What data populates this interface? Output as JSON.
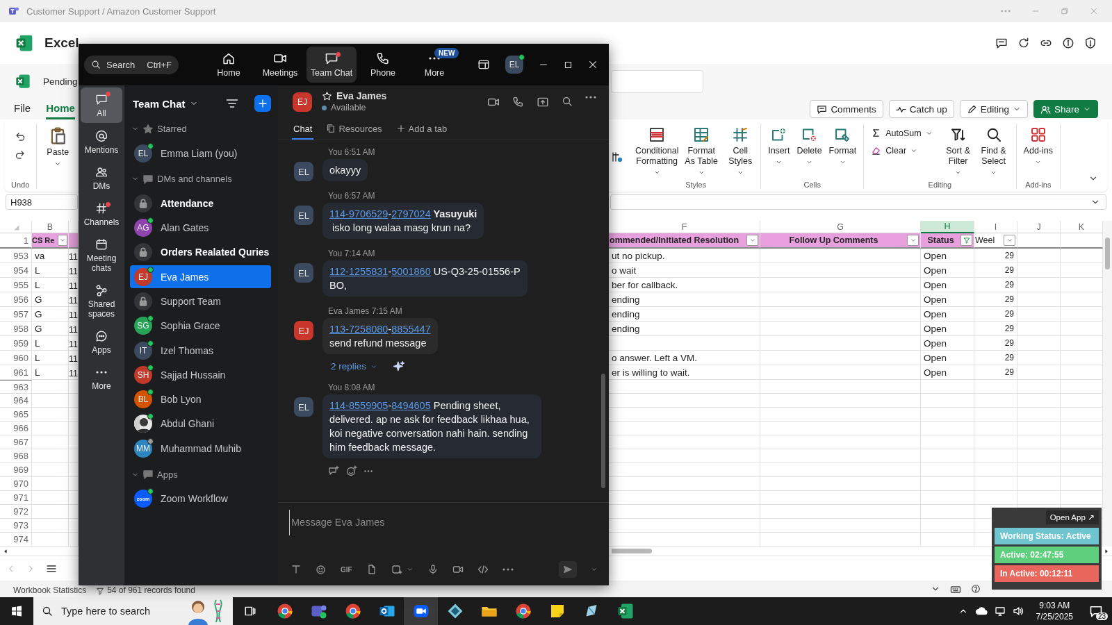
{
  "title_bar": {
    "title": "Customer Support / Amazon Customer Support"
  },
  "excel": {
    "app_name": "Excel",
    "file_name": "Pending",
    "ribbon_tabs": [
      {
        "label": "File",
        "selected": false
      },
      {
        "label": "Home",
        "selected": true
      }
    ],
    "share_buttons": [
      {
        "label": "Comments",
        "kind": "comments"
      },
      {
        "label": "Catch up",
        "kind": "catchup"
      },
      {
        "label": "Editing",
        "kind": "editing"
      },
      {
        "label": "Share",
        "kind": "share"
      }
    ],
    "ribbon_left": [
      {
        "label": "Undo",
        "kind": "undo"
      },
      {
        "label": "Paste",
        "kind": "paste"
      }
    ],
    "ribbon_groups": [
      {
        "label": "Styles",
        "commands": [
          {
            "label": "Conditional Formatting",
            "kind": "cond"
          },
          {
            "label": "Format As Table",
            "kind": "table"
          },
          {
            "label": "Cell Styles",
            "kind": "styles"
          }
        ]
      },
      {
        "label": "Cells",
        "commands": [
          {
            "label": "Insert",
            "kind": "insert"
          },
          {
            "label": "Delete",
            "kind": "delete"
          },
          {
            "label": "Format",
            "kind": "format"
          }
        ]
      },
      {
        "label": "Editing",
        "commands": [
          {
            "label": "AutoSum",
            "kind": "autosum"
          },
          {
            "label": "Clear",
            "kind": "clear"
          },
          {
            "label": "Sort & Filter",
            "kind": "sort"
          },
          {
            "label": "Find & Select",
            "kind": "find"
          }
        ]
      },
      {
        "label": "Add-ins",
        "commands": [
          {
            "label": "Add-ins",
            "kind": "addins"
          }
        ]
      }
    ],
    "name_box": "H938",
    "grid": {
      "columns": [
        {
          "letter": "B",
          "selected": false
        },
        {
          "letter": "F",
          "selected": false
        },
        {
          "letter": "G",
          "selected": false
        },
        {
          "letter": "H",
          "selected": true
        },
        {
          "letter": "I",
          "selected": false
        },
        {
          "letter": "J",
          "selected": false
        },
        {
          "letter": "K",
          "selected": false
        }
      ],
      "header_row": {
        "number": "1",
        "b": {
          "text": "CS Re",
          "filtered": false
        },
        "f": {
          "text": "ommended/Initiated Resolution",
          "filtered": false
        },
        "g": {
          "text": "Follow Up Comments",
          "filtered": false
        },
        "h": {
          "text": "Status",
          "filtered": true
        },
        "i": {
          "text": "Weel",
          "filtered": false
        }
      },
      "rows": [
        {
          "number": "953",
          "b": "va",
          "c": "11",
          "f": "ut no pickup.",
          "h": "Open",
          "i": "29"
        },
        {
          "number": "954",
          "b": "L",
          "c": "11",
          "f": "o wait",
          "h": "Open",
          "i": "29"
        },
        {
          "number": "955",
          "b": "L",
          "c": "11",
          "f": "ber for callback.",
          "h": "Open",
          "i": "29"
        },
        {
          "number": "956",
          "b": "G",
          "c": "11",
          "f": "ending",
          "h": "Open",
          "i": "29"
        },
        {
          "number": "957",
          "b": "G",
          "c": "11",
          "f": "ending",
          "h": "Open",
          "i": "29"
        },
        {
          "number": "958",
          "b": "G",
          "c": "11",
          "f": "ending",
          "h": "Open",
          "i": "29"
        },
        {
          "number": "959",
          "b": "L",
          "c": "11",
          "h": "Open",
          "i": "29"
        },
        {
          "number": "960",
          "b": "L",
          "c": "11",
          "f": "o answer. Left a VM.",
          "h": "Open",
          "i": "29"
        },
        {
          "number": "961",
          "b": "L",
          "c": "11",
          "f": "er is willing to wait.",
          "h": "Open",
          "i": "29"
        }
      ],
      "empty_rows": [
        "963",
        "964",
        "965",
        "966",
        "967",
        "968",
        "969",
        "970",
        "971",
        "972",
        "973",
        "974"
      ]
    },
    "status_bar": {
      "label": "Workbook Statistics",
      "records": "54 of 961 records found"
    }
  },
  "zoom": {
    "search": {
      "placeholder": "Search",
      "shortcut": "Ctrl+F"
    },
    "nav": [
      {
        "label": "Home",
        "selected": false,
        "dot": false
      },
      {
        "label": "Meetings",
        "selected": false,
        "dot": false
      },
      {
        "label": "Team Chat",
        "selected": true,
        "dot": true
      },
      {
        "label": "Phone",
        "selected": false,
        "dot": false
      },
      {
        "label": "More",
        "selected": false,
        "dot": false,
        "badge": "NEW"
      }
    ],
    "user": {
      "initials": "EL",
      "online": true
    },
    "rail": [
      {
        "label": "All",
        "selected": true,
        "dot": true
      },
      {
        "label": "Mentions",
        "selected": false,
        "dot": false
      },
      {
        "label": "DMs",
        "selected": false,
        "dot": false
      },
      {
        "label": "Channels",
        "selected": false,
        "dot": true
      },
      {
        "label": "Meeting chats",
        "selected": false,
        "dot": false
      },
      {
        "label": "Shared spaces",
        "selected": false,
        "dot": false
      },
      {
        "label": "Apps",
        "selected": false,
        "dot": false
      },
      {
        "label": "More",
        "selected": false,
        "dot": false
      }
    ],
    "sidebar": {
      "title": "Team Chat",
      "sections": [
        {
          "label": "Starred",
          "expanded": true,
          "items": [
            {
              "name": "Emma Liam (you)",
              "kind": "person",
              "initials": "EL",
              "color": "#3b4a5f",
              "online": true,
              "unread": false,
              "selected": false
            }
          ]
        },
        {
          "label": "DMs and channels",
          "expanded": true,
          "items": [
            {
              "name": "Attendance",
              "kind": "channel",
              "unread": true,
              "selected": false
            },
            {
              "name": "Alan Gates",
              "kind": "person",
              "initials": "AG",
              "color": "#8e44ad",
              "online": true,
              "unread": false,
              "selected": false
            },
            {
              "name": "Orders Realated Quries",
              "kind": "channel",
              "unread": true,
              "selected": false
            },
            {
              "name": "Eva James",
              "kind": "person",
              "initials": "EJ",
              "color": "#c0392b",
              "online": true,
              "unread": false,
              "selected": true
            },
            {
              "name": "Support Team",
              "kind": "channel",
              "unread": false,
              "selected": false
            },
            {
              "name": "Sophia Grace",
              "kind": "person",
              "initials": "SG",
              "color": "#27a35a",
              "online": true,
              "unread": false,
              "selected": false
            },
            {
              "name": "Izel Thomas",
              "kind": "person",
              "initials": "IT",
              "color": "#3b4a5f",
              "online": true,
              "unread": false,
              "selected": false
            },
            {
              "name": "Sajjad Hussain",
              "kind": "person",
              "initials": "SH",
              "color": "#c0392b",
              "online": true,
              "unread": false,
              "selected": false
            },
            {
              "name": "Bob Lyon",
              "kind": "person",
              "initials": "BL",
              "color": "#d35400",
              "online": true,
              "unread": false,
              "selected": false
            },
            {
              "name": "Abdul Ghani",
              "online": true,
              "unread": false,
              "selected": false
            },
            {
              "name": "Muhammad Muhib",
              "kind": "person",
              "initials": "MM",
              "color": "#2e86c1",
              "online": false,
              "away": true,
              "unread": false,
              "selected": false
            }
          ]
        },
        {
          "label": "Apps",
          "expanded": true,
          "items": [
            {
              "name": "Zoom Workflow",
              "kind": "app",
              "logo": "zoom",
              "online": true,
              "unread": false,
              "selected": false
            }
          ]
        }
      ]
    },
    "chat": {
      "contact": {
        "initials": "EJ",
        "color": "#c9372c",
        "name": "Eva James",
        "status": "Available",
        "online": true
      },
      "tabs": [
        {
          "label": "Chat",
          "selected": true,
          "kind": "chat"
        },
        {
          "label": "Resources",
          "selected": false,
          "kind": "resources"
        },
        {
          "label": "Add a tab",
          "selected": false,
          "kind": "add"
        }
      ],
      "messages": [
        {
          "meta": "You 6:51 AM",
          "kind": "sent",
          "initials": "EL",
          "color": "#3b4a5f",
          "parts": [
            {
              "kind": "text",
              "text": "okayyy"
            }
          ]
        },
        {
          "meta": "You 6:57 AM",
          "kind": "sent",
          "initials": "EL",
          "color": "#3b4a5f",
          "parts": [
            {
              "kind": "link",
              "text": "114-9706529"
            },
            {
              "kind": "text",
              "text": "-"
            },
            {
              "kind": "link",
              "text": "2797024"
            },
            {
              "kind": "bold",
              "text": " Yasuyuki"
            },
            {
              "kind": "text",
              "text": "\n isko long walaa masg krun na?"
            }
          ]
        },
        {
          "meta": "You 7:14 AM",
          "kind": "sent",
          "initials": "EL",
          "color": "#3b4a5f",
          "parts": [
            {
              "kind": "link",
              "text": "112-1255831"
            },
            {
              "kind": "text",
              "text": "-"
            },
            {
              "kind": "link",
              "text": "5001860"
            },
            {
              "kind": "text",
              "text": " US-Q3-25-01556-P\nBO,"
            }
          ]
        },
        {
          "meta": "Eva James 7:15 AM",
          "kind": "received",
          "initials": "EJ",
          "color": "#c9372c",
          "parts": [
            {
              "kind": "link",
              "text": "113-7258080"
            },
            {
              "kind": "text",
              "text": "-"
            },
            {
              "kind": "link",
              "text": "8855447"
            },
            {
              "kind": "text",
              "text": "\nsend refund message"
            }
          ],
          "replies": "2 replies"
        },
        {
          "meta": "You 8:08 AM",
          "kind": "sent",
          "initials": "EL",
          "color": "#3b4a5f",
          "parts": [
            {
              "kind": "link",
              "text": "114-8559905"
            },
            {
              "kind": "text",
              "text": "-"
            },
            {
              "kind": "link",
              "text": "8494605"
            },
            {
              "kind": "text",
              "text": " Pending sheet, delivered. ap ne ask for feedback likhaa hua, koi negative conversation nahi hain. sending him feedback message."
            }
          ]
        }
      ]
    },
    "composer": {
      "placeholder": "Message Eva James",
      "gif": "GIF"
    }
  },
  "widget": {
    "open_app": "Open App ↗",
    "rows": [
      {
        "text": "Working Status: Active",
        "color": "#6ec5cf"
      },
      {
        "text": "Active: 02:47:55",
        "color": "#5dcf7d"
      },
      {
        "text": "In Active: 00:12:11",
        "color": "#e8665b"
      }
    ]
  },
  "taskbar": {
    "search_placeholder": "Type here to search",
    "apps": [
      {
        "kind": "browser",
        "active": false
      },
      {
        "kind": "teams",
        "active": false
      },
      {
        "kind": "browser",
        "active": false
      },
      {
        "kind": "mail",
        "active": false
      },
      {
        "kind": "video",
        "active": true
      },
      {
        "kind": "diamond",
        "active": false
      },
      {
        "kind": "folder",
        "active": false
      },
      {
        "kind": "browser",
        "active": false
      },
      {
        "kind": "notes",
        "active": false
      },
      {
        "kind": "pen",
        "active": false
      },
      {
        "kind": "sheet",
        "active": false
      }
    ],
    "time": "9:03 AM",
    "date": "7/25/2025",
    "notifications": "23"
  }
}
